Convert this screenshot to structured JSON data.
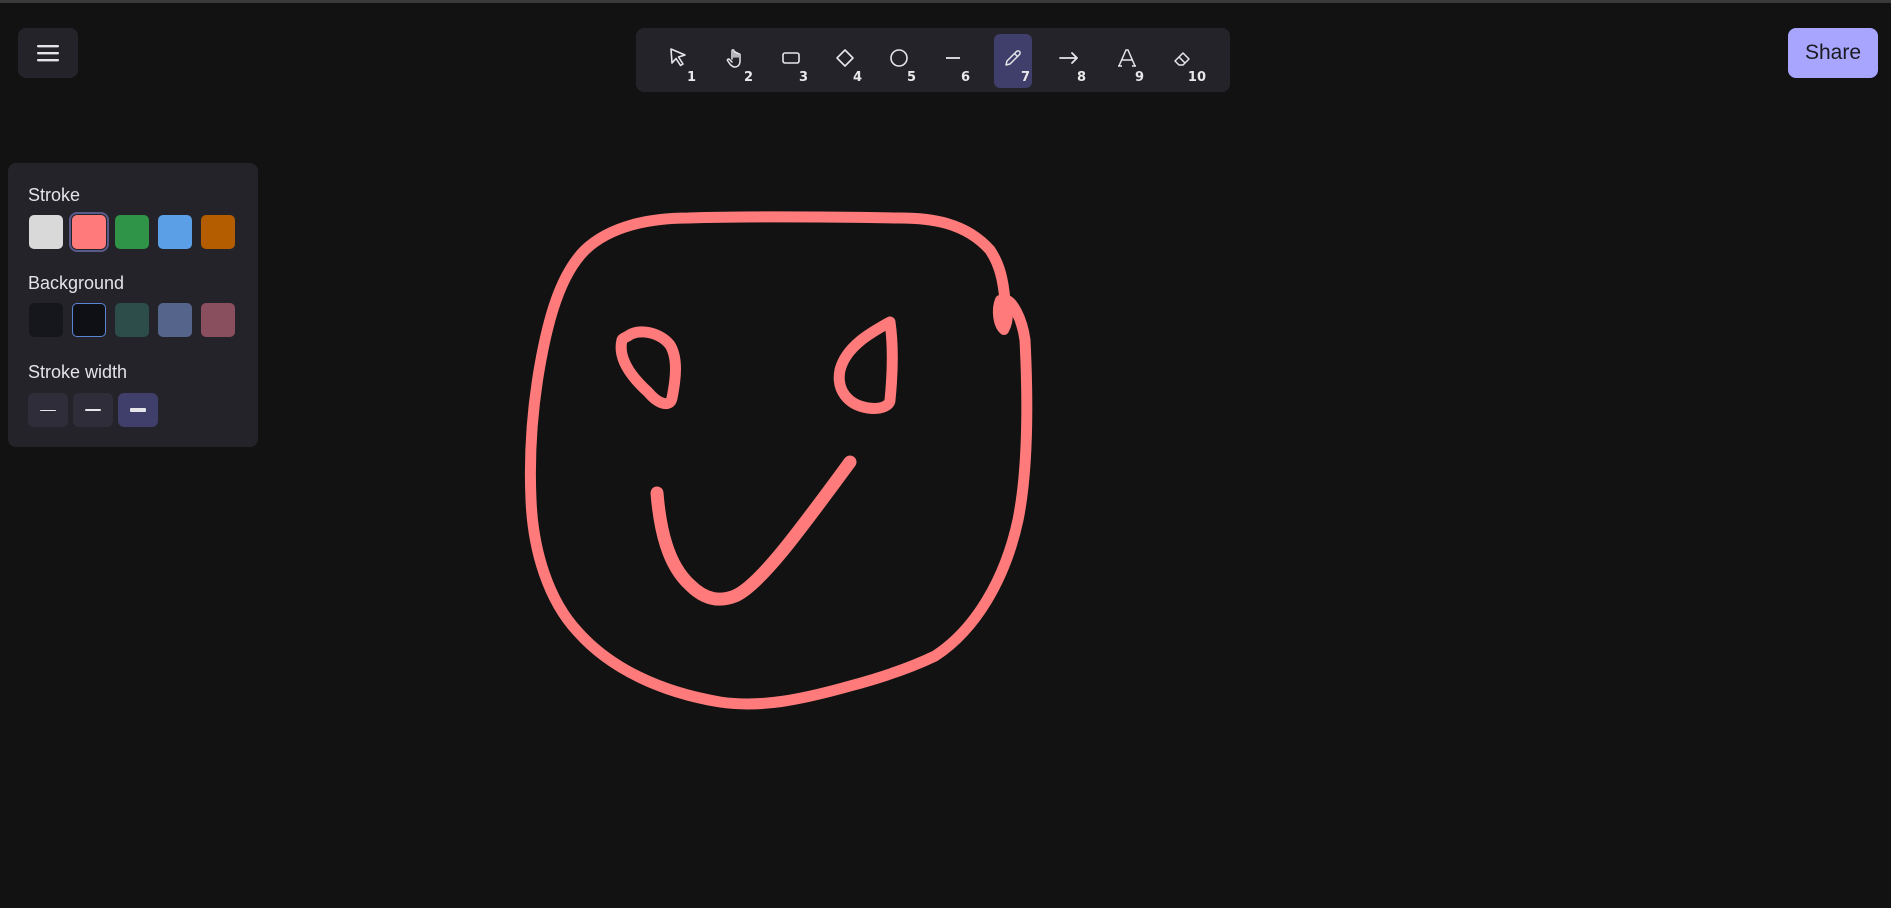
{
  "menu": {
    "icon": "hamburger-icon"
  },
  "toolbar": {
    "tools": [
      {
        "name": "selection",
        "icon": "pointer-icon",
        "shortcut": "1"
      },
      {
        "name": "hand",
        "icon": "hand-icon",
        "shortcut": "2"
      },
      {
        "name": "rectangle",
        "icon": "rectangle-icon",
        "shortcut": "3"
      },
      {
        "name": "diamond",
        "icon": "diamond-icon",
        "shortcut": "4"
      },
      {
        "name": "ellipse",
        "icon": "circle-icon",
        "shortcut": "5"
      },
      {
        "name": "line",
        "icon": "line-icon",
        "shortcut": "6"
      },
      {
        "name": "freedraw",
        "icon": "pencil-icon",
        "shortcut": "7",
        "active": true
      },
      {
        "name": "arrow",
        "icon": "arrow-icon",
        "shortcut": "8"
      },
      {
        "name": "text",
        "icon": "text-icon",
        "shortcut": "9"
      },
      {
        "name": "eraser",
        "icon": "eraser-icon",
        "shortcut": "10"
      }
    ]
  },
  "share": {
    "label": "Share",
    "color": "#a8a5ff"
  },
  "panel": {
    "stroke_label": "Stroke",
    "stroke_colors": [
      "#d9d9d9",
      "#ff7b7b",
      "#2f9447",
      "#5b9fe6",
      "#b35c00"
    ],
    "stroke_selected": 1,
    "background_label": "Background",
    "background_colors": [
      "#16171c",
      "#0f1015",
      "#2d4d4a",
      "#55648a",
      "#8a4f5e"
    ],
    "background_selected": 1,
    "stroke_width_label": "Stroke width",
    "stroke_widths": [
      "thin",
      "bold",
      "extra-bold"
    ],
    "stroke_width_selected": 2
  },
  "canvas": {
    "drawing": "smiley-face-freehand",
    "stroke_color": "#ff7b7b"
  }
}
